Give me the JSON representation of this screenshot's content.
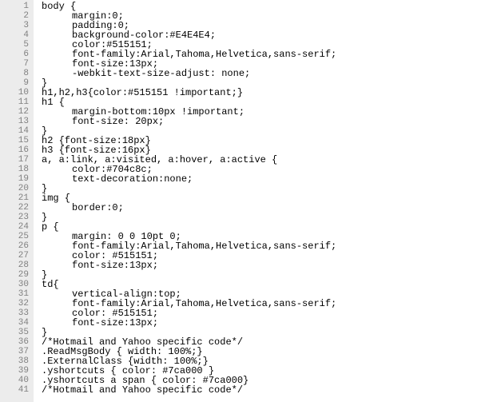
{
  "lines": [
    {
      "n": 1,
      "indent": 0,
      "t": "body {"
    },
    {
      "n": 2,
      "indent": 1,
      "t": "margin:0;"
    },
    {
      "n": 3,
      "indent": 1,
      "t": "padding:0;"
    },
    {
      "n": 4,
      "indent": 1,
      "t": "background-color:#E4E4E4;"
    },
    {
      "n": 5,
      "indent": 1,
      "t": "color:#515151;"
    },
    {
      "n": 6,
      "indent": 1,
      "t": "font-family:Arial,Tahoma,Helvetica,sans-serif;"
    },
    {
      "n": 7,
      "indent": 1,
      "t": "font-size:13px;"
    },
    {
      "n": 8,
      "indent": 1,
      "t": "-webkit-text-size-adjust: none;"
    },
    {
      "n": 9,
      "indent": 0,
      "t": "}"
    },
    {
      "n": 10,
      "indent": 0,
      "t": "h1,h2,h3{color:#515151 !important;}"
    },
    {
      "n": 11,
      "indent": 0,
      "t": "h1 {"
    },
    {
      "n": 12,
      "indent": 1,
      "t": "margin-bottom:10px !important;"
    },
    {
      "n": 13,
      "indent": 1,
      "t": "font-size: 20px;"
    },
    {
      "n": 14,
      "indent": 0,
      "t": "}"
    },
    {
      "n": 15,
      "indent": 0,
      "t": "h2 {font-size:18px}"
    },
    {
      "n": 16,
      "indent": 0,
      "t": "h3 {font-size:16px}"
    },
    {
      "n": 17,
      "indent": 0,
      "t": "a, a:link, a:visited, a:hover, a:active {"
    },
    {
      "n": 18,
      "indent": 1,
      "t": "color:#704c8c;"
    },
    {
      "n": 19,
      "indent": 1,
      "t": "text-decoration:none;"
    },
    {
      "n": 20,
      "indent": 0,
      "t": "}"
    },
    {
      "n": 21,
      "indent": 0,
      "t": "img {"
    },
    {
      "n": 22,
      "indent": 1,
      "t": "border:0;"
    },
    {
      "n": 23,
      "indent": 0,
      "t": "}"
    },
    {
      "n": 24,
      "indent": 0,
      "t": "p {"
    },
    {
      "n": 25,
      "indent": 1,
      "t": "margin: 0 0 10pt 0;"
    },
    {
      "n": 26,
      "indent": 1,
      "t": "font-family:Arial,Tahoma,Helvetica,sans-serif;"
    },
    {
      "n": 27,
      "indent": 1,
      "t": "color: #515151;"
    },
    {
      "n": 28,
      "indent": 1,
      "t": "font-size:13px;"
    },
    {
      "n": 29,
      "indent": 0,
      "t": "}"
    },
    {
      "n": 30,
      "indent": 0,
      "t": "td{"
    },
    {
      "n": 31,
      "indent": 1,
      "t": "vertical-align:top;"
    },
    {
      "n": 32,
      "indent": 1,
      "t": "font-family:Arial,Tahoma,Helvetica,sans-serif;"
    },
    {
      "n": 33,
      "indent": 1,
      "t": "color: #515151;"
    },
    {
      "n": 34,
      "indent": 1,
      "t": "font-size:13px;"
    },
    {
      "n": 35,
      "indent": 0,
      "t": "}"
    },
    {
      "n": 36,
      "indent": 0,
      "t": "/*Hotmail and Yahoo specific code*/"
    },
    {
      "n": 37,
      "indent": 0,
      "t": ".ReadMsgBody { width: 100%;}"
    },
    {
      "n": 38,
      "indent": 0,
      "t": ".ExternalClass {width: 100%;}"
    },
    {
      "n": 39,
      "indent": 0,
      "t": ".yshortcuts { color: #7ca000 }"
    },
    {
      "n": 40,
      "indent": 0,
      "t": ".yshortcuts a span { color: #7ca000}"
    },
    {
      "n": 41,
      "indent": 0,
      "t": "/*Hotmail and Yahoo specific code*/"
    }
  ]
}
